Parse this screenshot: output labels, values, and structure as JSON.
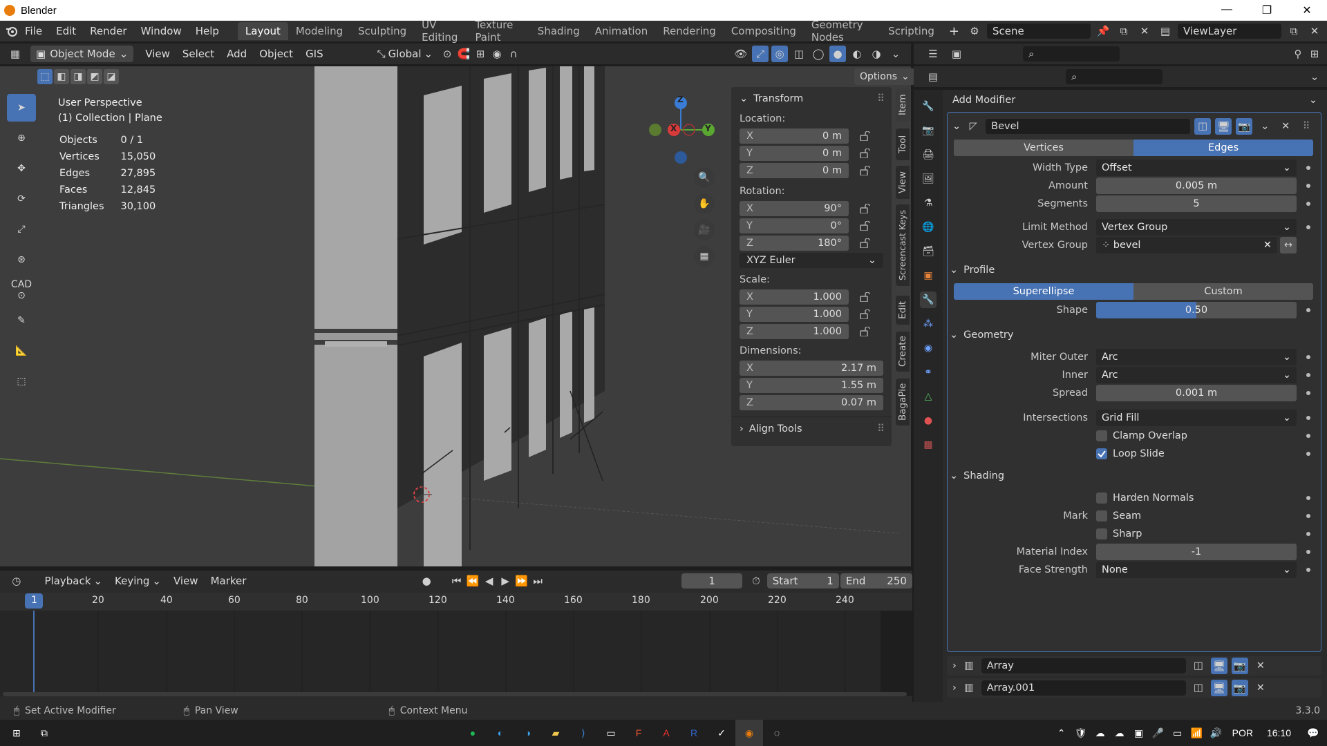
{
  "window": {
    "title": "Blender"
  },
  "menus": [
    "File",
    "Edit",
    "Render",
    "Window",
    "Help"
  ],
  "workspaces": [
    "Layout",
    "Modeling",
    "Sculpting",
    "UV Editing",
    "Texture Paint",
    "Shading",
    "Animation",
    "Rendering",
    "Compositing",
    "Geometry Nodes",
    "Scripting"
  ],
  "scene": {
    "name": "Scene",
    "viewlayer": "ViewLayer"
  },
  "viewport_header": {
    "mode": "Object Mode",
    "items": [
      "View",
      "Select",
      "Add",
      "Object",
      "GIS"
    ],
    "orientation": "Global",
    "options": "Options"
  },
  "stats": {
    "view": "User Perspective",
    "collection": "(1) Collection | Plane",
    "rows": [
      {
        "k": "Objects",
        "v": "0 / 1"
      },
      {
        "k": "Vertices",
        "v": "15,050"
      },
      {
        "k": "Edges",
        "v": "27,895"
      },
      {
        "k": "Faces",
        "v": "12,845"
      },
      {
        "k": "Triangles",
        "v": "30,100"
      }
    ]
  },
  "tools": {
    "cad": "CAD"
  },
  "npanel": {
    "transform": "Transform",
    "location_label": "Location:",
    "location": [
      {
        "k": "X",
        "v": "0 m"
      },
      {
        "k": "Y",
        "v": "0 m"
      },
      {
        "k": "Z",
        "v": "0 m"
      }
    ],
    "rotation_label": "Rotation:",
    "rotation": [
      {
        "k": "X",
        "v": "90°"
      },
      {
        "k": "Y",
        "v": "0°"
      },
      {
        "k": "Z",
        "v": "180°"
      }
    ],
    "rotation_mode": "XYZ Euler",
    "scale_label": "Scale:",
    "scale": [
      {
        "k": "X",
        "v": "1.000"
      },
      {
        "k": "Y",
        "v": "1.000"
      },
      {
        "k": "Z",
        "v": "1.000"
      }
    ],
    "dimensions_label": "Dimensions:",
    "dimensions": [
      {
        "k": "X",
        "v": "2.17 m"
      },
      {
        "k": "Y",
        "v": "1.55 m"
      },
      {
        "k": "Z",
        "v": "0.07 m"
      }
    ],
    "align_tools": "Align Tools",
    "tabs": [
      "Item",
      "Tool",
      "View",
      "Screencast Keys",
      "Edit",
      "Create",
      "BagaPie"
    ]
  },
  "gizmo": {
    "x": "X",
    "y": "Y",
    "z": "Z"
  },
  "timeline": {
    "menus": [
      "Playback",
      "Keying",
      "View",
      "Marker"
    ],
    "current": "1",
    "start_label": "Start",
    "start": "1",
    "end_label": "End",
    "end": "250",
    "ticks": [
      "20",
      "40",
      "60",
      "80",
      "100",
      "120",
      "140",
      "160",
      "180",
      "200",
      "220",
      "240"
    ],
    "frame": "1"
  },
  "status": {
    "left": "Set Active Modifier",
    "mid": "Pan View",
    "right": "Context Menu",
    "version": "3.3.0"
  },
  "properties": {
    "add_modifier": "Add Modifier",
    "bevel": {
      "name": "Bevel",
      "mode_vertices": "Vertices",
      "mode_edges": "Edges",
      "width_type_label": "Width Type",
      "width_type": "Offset",
      "amount_label": "Amount",
      "amount": "0.005 m",
      "segments_label": "Segments",
      "segments": "5",
      "limit_label": "Limit Method",
      "limit": "Vertex Group",
      "vgroup_label": "Vertex Group",
      "vgroup": "bevel",
      "profile": "Profile",
      "profile_superellipse": "Superellipse",
      "profile_custom": "Custom",
      "shape_label": "Shape",
      "shape": "0.50",
      "shape_fraction": 0.5,
      "geometry": "Geometry",
      "miter_outer_label": "Miter Outer",
      "miter_outer": "Arc",
      "inner_label": "Inner",
      "inner": "Arc",
      "spread_label": "Spread",
      "spread": "0.001 m",
      "intersections_label": "Intersections",
      "intersections": "Grid Fill",
      "clamp": "Clamp Overlap",
      "clamp_checked": false,
      "loop_slide": "Loop Slide",
      "loop_slide_checked": true,
      "shading": "Shading",
      "harden": "Harden Normals",
      "mark_label": "Mark",
      "seam": "Seam",
      "sharp": "Sharp",
      "material_label": "Material Index",
      "material": "-1",
      "face_strength_label": "Face Strength",
      "face_strength": "None"
    },
    "modifiers": [
      "Array",
      "Array.001"
    ]
  },
  "taskbar": {
    "lang": "POR",
    "time": "16:10"
  },
  "colors": {
    "accent": "#4772b3",
    "bg": "#303030"
  }
}
